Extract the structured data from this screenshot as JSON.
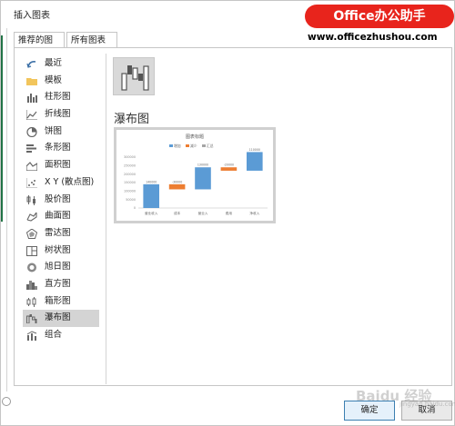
{
  "dialog": {
    "title": "插入图表",
    "brand": "Office办公助手",
    "brand_url": "www.officezhushou.com",
    "tabs": [
      {
        "label": "推荐的图表"
      },
      {
        "label": "所有图表"
      }
    ],
    "categories": [
      {
        "label": "最近",
        "icon": "recent-icon"
      },
      {
        "label": "模板",
        "icon": "folder-icon"
      },
      {
        "label": "柱形图",
        "icon": "column-chart-icon"
      },
      {
        "label": "折线图",
        "icon": "line-chart-icon"
      },
      {
        "label": "饼图",
        "icon": "pie-chart-icon"
      },
      {
        "label": "条形图",
        "icon": "bar-chart-icon"
      },
      {
        "label": "面积图",
        "icon": "area-chart-icon"
      },
      {
        "label": "X Y (散点图)",
        "icon": "scatter-chart-icon"
      },
      {
        "label": "股价图",
        "icon": "stock-chart-icon"
      },
      {
        "label": "曲面图",
        "icon": "surface-chart-icon"
      },
      {
        "label": "雷达图",
        "icon": "radar-chart-icon"
      },
      {
        "label": "树状图",
        "icon": "treemap-chart-icon"
      },
      {
        "label": "旭日图",
        "icon": "sunburst-chart-icon"
      },
      {
        "label": "直方图",
        "icon": "histogram-chart-icon"
      },
      {
        "label": "箱形图",
        "icon": "box-chart-icon"
      },
      {
        "label": "瀑布图",
        "icon": "waterfall-chart-icon",
        "selected": true
      },
      {
        "label": "组合",
        "icon": "combo-chart-icon"
      }
    ],
    "selected_chart_name": "瀑布图",
    "ok_label": "确定",
    "cancel_label": "取消",
    "watermark": "Baidu 经验",
    "watermark_sub": "jingyan.baidu.com"
  },
  "chart_data": {
    "type": "waterfall",
    "title": "图表标题",
    "legend": [
      "增加",
      "减少",
      "汇总"
    ],
    "legend_placement": "top",
    "colors": {
      "increase": "#5b9bd5",
      "decrease": "#ed7d31",
      "total": "#a5a5a5"
    },
    "categories": [
      "营业收入",
      "成本",
      "营业入",
      "费用",
      "净收入"
    ],
    "series": [
      {
        "name": "增加",
        "values": [
          140000,
          0,
          130000,
          0,
          110000
        ]
      },
      {
        "name": "减少",
        "values": [
          0,
          30000,
          0,
          20000,
          0
        ]
      }
    ],
    "bar_labels": [
      "140000",
      "-30000",
      "130000",
      "-20000",
      "110000"
    ],
    "ylim": [
      0,
      300000
    ],
    "yticks": [
      0,
      50000,
      100000,
      150000,
      200000,
      250000,
      300000
    ],
    "grid": false
  }
}
